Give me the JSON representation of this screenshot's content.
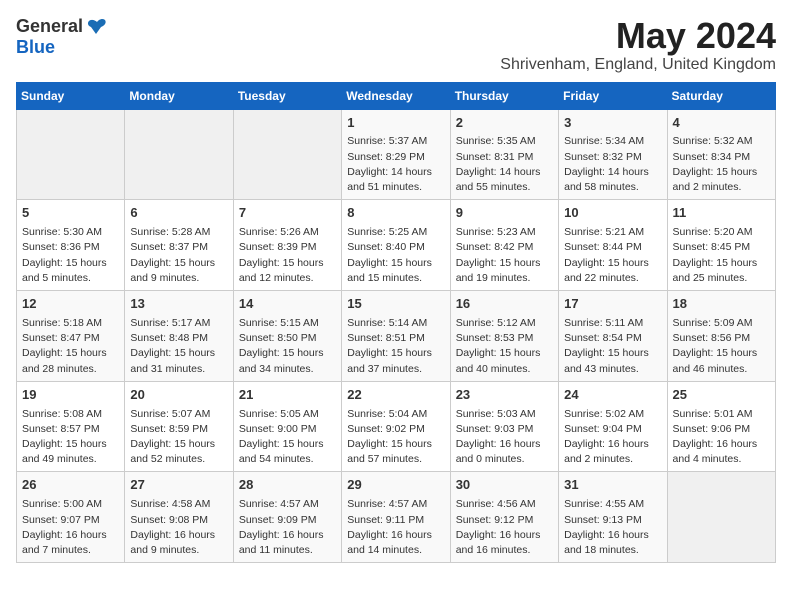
{
  "logo": {
    "general": "General",
    "blue": "Blue"
  },
  "title": {
    "month_year": "May 2024",
    "location": "Shrivenham, England, United Kingdom"
  },
  "days_of_week": [
    "Sunday",
    "Monday",
    "Tuesday",
    "Wednesday",
    "Thursday",
    "Friday",
    "Saturday"
  ],
  "weeks": [
    {
      "days": [
        {
          "num": "",
          "info": ""
        },
        {
          "num": "",
          "info": ""
        },
        {
          "num": "",
          "info": ""
        },
        {
          "num": "1",
          "info": "Sunrise: 5:37 AM\nSunset: 8:29 PM\nDaylight: 14 hours\nand 51 minutes."
        },
        {
          "num": "2",
          "info": "Sunrise: 5:35 AM\nSunset: 8:31 PM\nDaylight: 14 hours\nand 55 minutes."
        },
        {
          "num": "3",
          "info": "Sunrise: 5:34 AM\nSunset: 8:32 PM\nDaylight: 14 hours\nand 58 minutes."
        },
        {
          "num": "4",
          "info": "Sunrise: 5:32 AM\nSunset: 8:34 PM\nDaylight: 15 hours\nand 2 minutes."
        }
      ]
    },
    {
      "days": [
        {
          "num": "5",
          "info": "Sunrise: 5:30 AM\nSunset: 8:36 PM\nDaylight: 15 hours\nand 5 minutes."
        },
        {
          "num": "6",
          "info": "Sunrise: 5:28 AM\nSunset: 8:37 PM\nDaylight: 15 hours\nand 9 minutes."
        },
        {
          "num": "7",
          "info": "Sunrise: 5:26 AM\nSunset: 8:39 PM\nDaylight: 15 hours\nand 12 minutes."
        },
        {
          "num": "8",
          "info": "Sunrise: 5:25 AM\nSunset: 8:40 PM\nDaylight: 15 hours\nand 15 minutes."
        },
        {
          "num": "9",
          "info": "Sunrise: 5:23 AM\nSunset: 8:42 PM\nDaylight: 15 hours\nand 19 minutes."
        },
        {
          "num": "10",
          "info": "Sunrise: 5:21 AM\nSunset: 8:44 PM\nDaylight: 15 hours\nand 22 minutes."
        },
        {
          "num": "11",
          "info": "Sunrise: 5:20 AM\nSunset: 8:45 PM\nDaylight: 15 hours\nand 25 minutes."
        }
      ]
    },
    {
      "days": [
        {
          "num": "12",
          "info": "Sunrise: 5:18 AM\nSunset: 8:47 PM\nDaylight: 15 hours\nand 28 minutes."
        },
        {
          "num": "13",
          "info": "Sunrise: 5:17 AM\nSunset: 8:48 PM\nDaylight: 15 hours\nand 31 minutes."
        },
        {
          "num": "14",
          "info": "Sunrise: 5:15 AM\nSunset: 8:50 PM\nDaylight: 15 hours\nand 34 minutes."
        },
        {
          "num": "15",
          "info": "Sunrise: 5:14 AM\nSunset: 8:51 PM\nDaylight: 15 hours\nand 37 minutes."
        },
        {
          "num": "16",
          "info": "Sunrise: 5:12 AM\nSunset: 8:53 PM\nDaylight: 15 hours\nand 40 minutes."
        },
        {
          "num": "17",
          "info": "Sunrise: 5:11 AM\nSunset: 8:54 PM\nDaylight: 15 hours\nand 43 minutes."
        },
        {
          "num": "18",
          "info": "Sunrise: 5:09 AM\nSunset: 8:56 PM\nDaylight: 15 hours\nand 46 minutes."
        }
      ]
    },
    {
      "days": [
        {
          "num": "19",
          "info": "Sunrise: 5:08 AM\nSunset: 8:57 PM\nDaylight: 15 hours\nand 49 minutes."
        },
        {
          "num": "20",
          "info": "Sunrise: 5:07 AM\nSunset: 8:59 PM\nDaylight: 15 hours\nand 52 minutes."
        },
        {
          "num": "21",
          "info": "Sunrise: 5:05 AM\nSunset: 9:00 PM\nDaylight: 15 hours\nand 54 minutes."
        },
        {
          "num": "22",
          "info": "Sunrise: 5:04 AM\nSunset: 9:02 PM\nDaylight: 15 hours\nand 57 minutes."
        },
        {
          "num": "23",
          "info": "Sunrise: 5:03 AM\nSunset: 9:03 PM\nDaylight: 16 hours\nand 0 minutes."
        },
        {
          "num": "24",
          "info": "Sunrise: 5:02 AM\nSunset: 9:04 PM\nDaylight: 16 hours\nand 2 minutes."
        },
        {
          "num": "25",
          "info": "Sunrise: 5:01 AM\nSunset: 9:06 PM\nDaylight: 16 hours\nand 4 minutes."
        }
      ]
    },
    {
      "days": [
        {
          "num": "26",
          "info": "Sunrise: 5:00 AM\nSunset: 9:07 PM\nDaylight: 16 hours\nand 7 minutes."
        },
        {
          "num": "27",
          "info": "Sunrise: 4:58 AM\nSunset: 9:08 PM\nDaylight: 16 hours\nand 9 minutes."
        },
        {
          "num": "28",
          "info": "Sunrise: 4:57 AM\nSunset: 9:09 PM\nDaylight: 16 hours\nand 11 minutes."
        },
        {
          "num": "29",
          "info": "Sunrise: 4:57 AM\nSunset: 9:11 PM\nDaylight: 16 hours\nand 14 minutes."
        },
        {
          "num": "30",
          "info": "Sunrise: 4:56 AM\nSunset: 9:12 PM\nDaylight: 16 hours\nand 16 minutes."
        },
        {
          "num": "31",
          "info": "Sunrise: 4:55 AM\nSunset: 9:13 PM\nDaylight: 16 hours\nand 18 minutes."
        },
        {
          "num": "",
          "info": ""
        }
      ]
    }
  ]
}
